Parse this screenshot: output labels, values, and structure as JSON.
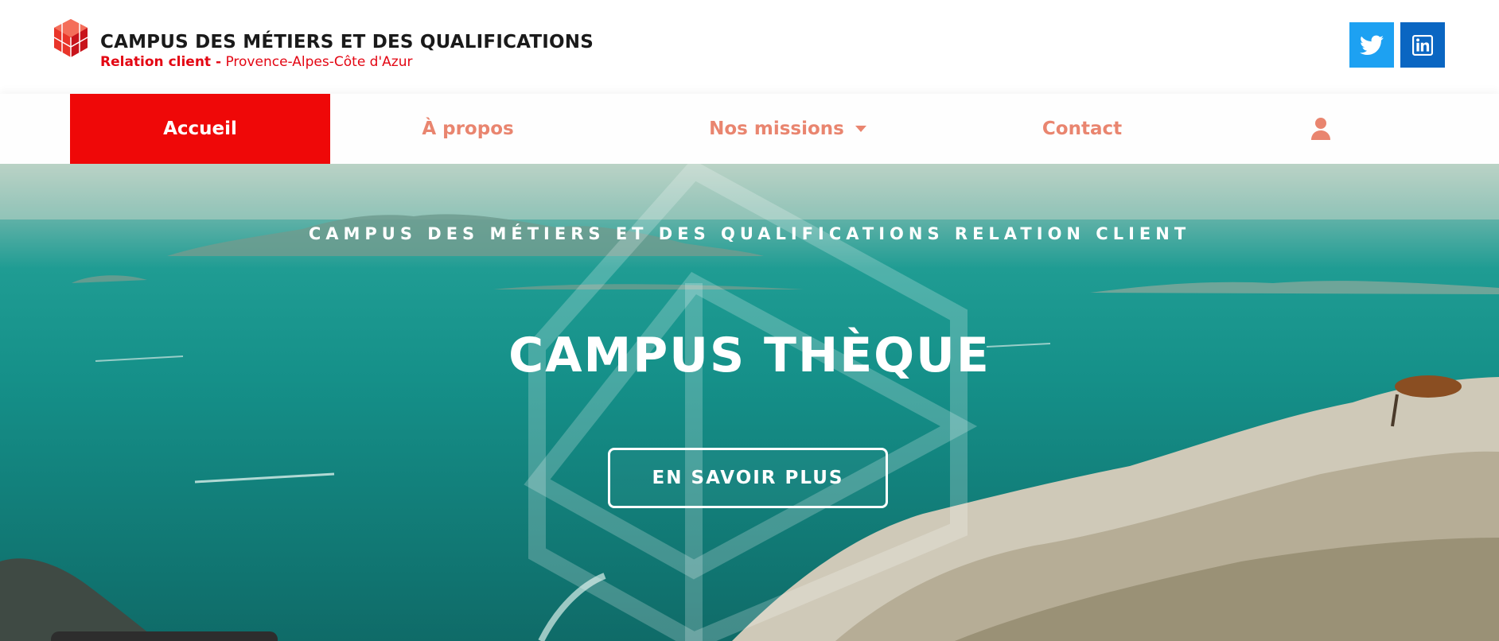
{
  "header": {
    "logo_title": "CAMPUS DES MÉTIERS ET DES QUALIFICATIONS",
    "logo_sub_strong": "Relation client -",
    "logo_sub_region": "Provence-Alpes-Côte d'Azur",
    "social": [
      {
        "name": "twitter-icon",
        "color": "#1da1f2"
      },
      {
        "name": "linkedin-icon",
        "color": "#0a66c2"
      }
    ]
  },
  "nav": {
    "items": [
      {
        "label": "Accueil",
        "active": true
      },
      {
        "label": "À propos"
      },
      {
        "label": "Nos missions",
        "has_dropdown": true
      },
      {
        "label": "Contact"
      },
      {
        "icon": "user-icon"
      }
    ],
    "active_color": "#ef0808",
    "link_color": "#e9856f"
  },
  "hero": {
    "kicker": "CAMPUS DES MÉTIERS ET DES QUALIFICATIONS RELATION CLIENT",
    "title": "CAMPUS THÈQUE",
    "cta_label": "EN SAVOIR PLUS"
  }
}
